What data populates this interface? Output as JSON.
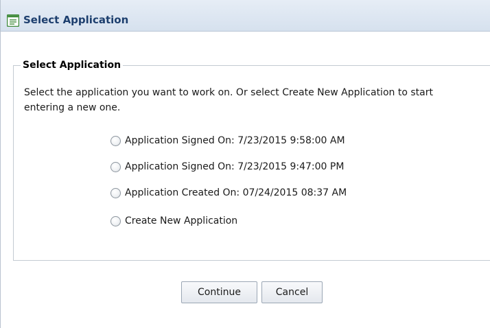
{
  "window": {
    "title": "Select Application"
  },
  "group": {
    "legend": "Select Application",
    "instructions": "Select the application you want to work on. Or select Create New Application to start entering a new one."
  },
  "options": [
    {
      "label": "Application Signed On: 7/23/2015 9:58:00 AM",
      "selected": false
    },
    {
      "label": "Application Signed On: 7/23/2015 9:47:00 PM",
      "selected": false
    },
    {
      "label": "Application Created On: 07/24/2015 08:37 AM",
      "selected": false
    },
    {
      "label": "Create New Application",
      "selected": false
    }
  ],
  "buttons": {
    "continue_label": "Continue",
    "cancel_label": "Cancel"
  },
  "colors": {
    "title_text": "#1d3f6e",
    "title_bar": "#dfe7f1",
    "icon_green": "#3f8a3a"
  },
  "icons": {
    "title": "form-icon"
  }
}
